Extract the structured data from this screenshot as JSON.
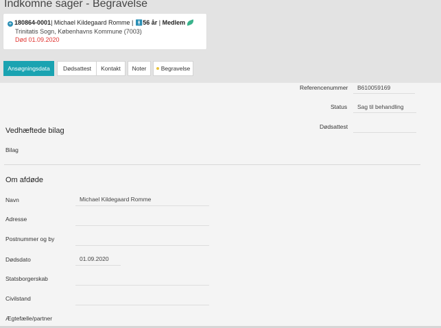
{
  "header": {
    "title": "Indkomne sager - Begravelse"
  },
  "person": {
    "case_id": "180864-0001",
    "name": "Michael Kildegaard Romme",
    "age": "56 år",
    "membership": "Medlem",
    "parish": "Trinitatis Sogn, Københavns Kommune (7003)",
    "death_note": "Død 01.09.2020",
    "colors": {
      "accent": "#2b8fb5",
      "alert": "#e0312d",
      "leaf": "#3bb38c"
    }
  },
  "tabs": [
    {
      "label": "Ansøgningsdata",
      "active": true
    },
    {
      "label": "Dødsattest",
      "active": false
    },
    {
      "label": "Kontakt",
      "active": false
    },
    {
      "label": "Noter",
      "active": false
    },
    {
      "label": "Begravelse",
      "active": false
    }
  ],
  "meta": {
    "reference_label": "Referencenummer",
    "reference_value": "B610059169",
    "status_label": "Status",
    "status_value": "Sag til behandling",
    "certificate_label": "Dødsattest",
    "certificate_value": ""
  },
  "attachments": {
    "title": "Vedhæftede bilag",
    "bilag_label": "Bilag"
  },
  "deceased": {
    "title": "Om afdøde",
    "name_label": "Navn",
    "name_value": "Michael Kildegaard Romme",
    "address_label": "Adresse",
    "address_value": "",
    "postal_label": "Postnummer og by",
    "postal_value": "",
    "death_date_label": "Dødsdato",
    "death_date_value": "01.09.2020",
    "citizenship_label": "Statsborgerskab",
    "citizenship_value": "",
    "civil_status_label": "Civilstand",
    "civil_status_value": "",
    "spouse_label": "Ægtefælle/partner"
  }
}
